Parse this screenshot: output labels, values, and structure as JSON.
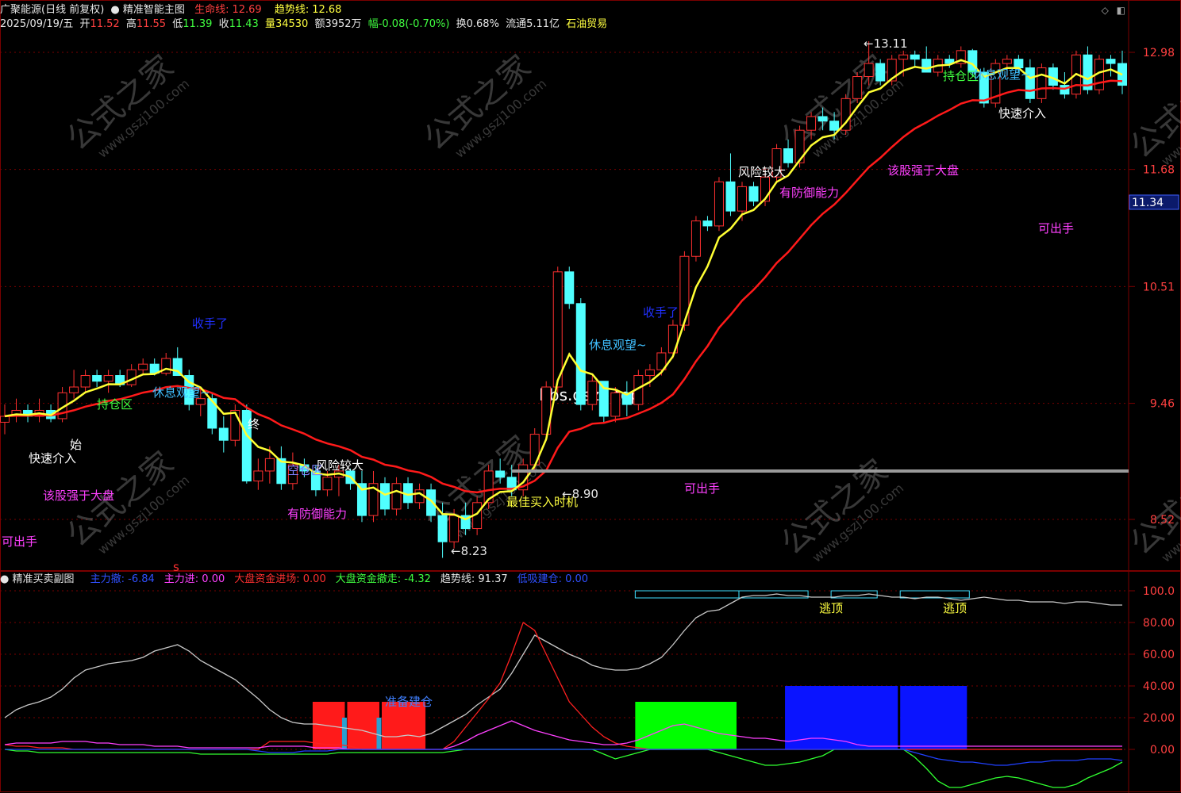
{
  "colors": {
    "bg": "#000000",
    "grid": "#7a0000",
    "up": "#ff3030",
    "down": "#50ffff",
    "life_line": "#ff1a1a",
    "trend_line": "#ffff33",
    "white_line": "#c8c8c8",
    "magenta": "#ff40ff",
    "blue": "#2040ff",
    "green": "#30ff30"
  },
  "header_main": {
    "stock": "广聚能源(日线 前复权)",
    "indicator": "精准智能主图",
    "life_label": "生命线:",
    "life_value": "12.69",
    "trend_label": "趋势线:",
    "trend_value": "12.68",
    "date": "2025/09/19/五",
    "open_label": "开",
    "open": "11.52",
    "high_label": "高",
    "high": "11.55",
    "low_label": "低",
    "low": "11.39",
    "close_label": "收",
    "close": "11.43",
    "vol_label": "量",
    "vol": "34530",
    "amount": "额3952万",
    "change": "幅-0.08(-0.70%)",
    "turnover": "换0.68%",
    "float": "流通5.11亿",
    "industry": "石油贸易"
  },
  "header_sub": {
    "indicator": "精准买卖副图",
    "items": [
      {
        "label": "主力撤: ",
        "value": "-6.84",
        "color": "#3050ff"
      },
      {
        "label": "主力进: ",
        "value": "0.00",
        "color": "#ff40ff"
      },
      {
        "label": "大盘资金进场: ",
        "value": "0.00",
        "color": "#ff3030"
      },
      {
        "label": "大盘资金撤走: ",
        "value": "-4.32",
        "color": "#40ff40"
      },
      {
        "label": "趋势线: ",
        "value": "91.37",
        "color": "#e6e6e6"
      },
      {
        "label": "低吸建仓: ",
        "value": "0.00",
        "color": "#3050ff"
      }
    ]
  },
  "watermark": {
    "brand": "公式之家",
    "url": "www.gszj100.com",
    "site": "bbs.gszb.top"
  },
  "chart_data": [
    {
      "type": "candlestick",
      "y_ticks": [
        "12.98",
        "11.68",
        "10.51",
        "9.46",
        "8.52"
      ],
      "current_price": "11.34",
      "candles": [
        [
          9.3,
          9.45,
          9.2,
          9.35
        ],
        [
          9.35,
          9.5,
          9.3,
          9.4
        ],
        [
          9.4,
          9.45,
          9.3,
          9.35
        ],
        [
          9.35,
          9.5,
          9.3,
          9.4
        ],
        [
          9.4,
          9.45,
          9.3,
          9.33
        ],
        [
          9.33,
          9.6,
          9.3,
          9.55
        ],
        [
          9.55,
          9.75,
          9.5,
          9.6
        ],
        [
          9.6,
          9.75,
          9.55,
          9.7
        ],
        [
          9.7,
          9.75,
          9.6,
          9.65
        ],
        [
          9.65,
          9.75,
          9.55,
          9.7
        ],
        [
          9.7,
          9.75,
          9.6,
          9.62
        ],
        [
          9.62,
          9.8,
          9.6,
          9.75
        ],
        [
          9.75,
          9.85,
          9.7,
          9.8
        ],
        [
          9.8,
          9.85,
          9.7,
          9.72
        ],
        [
          9.72,
          9.9,
          9.7,
          9.85
        ],
        [
          9.85,
          9.95,
          9.7,
          9.7
        ],
        [
          9.7,
          9.75,
          9.4,
          9.45
        ],
        [
          9.45,
          9.6,
          9.35,
          9.5
        ],
        [
          9.5,
          9.55,
          9.2,
          9.25
        ],
        [
          9.25,
          9.35,
          9.05,
          9.15
        ],
        [
          9.15,
          9.45,
          9.1,
          9.4
        ],
        [
          9.4,
          9.45,
          8.8,
          8.82
        ],
        [
          8.82,
          9.0,
          8.75,
          8.9
        ],
        [
          8.9,
          9.1,
          8.8,
          9.0
        ],
        [
          9.0,
          9.1,
          8.75,
          8.8
        ],
        [
          8.8,
          9.05,
          8.75,
          8.95
        ],
        [
          8.95,
          9.0,
          8.85,
          8.9
        ],
        [
          8.9,
          8.95,
          8.7,
          8.75
        ],
        [
          8.75,
          8.9,
          8.7,
          8.85
        ],
        [
          8.85,
          8.95,
          8.7,
          8.9
        ],
        [
          8.9,
          8.92,
          8.75,
          8.8
        ],
        [
          8.8,
          8.9,
          8.5,
          8.55
        ],
        [
          8.55,
          8.9,
          8.5,
          8.8
        ],
        [
          8.8,
          8.85,
          8.55,
          8.6
        ],
        [
          8.6,
          8.85,
          8.55,
          8.8
        ],
        [
          8.8,
          8.85,
          8.6,
          8.65
        ],
        [
          8.65,
          8.8,
          8.6,
          8.75
        ],
        [
          8.75,
          8.8,
          8.5,
          8.55
        ],
        [
          8.55,
          8.65,
          8.23,
          8.35
        ],
        [
          8.35,
          8.6,
          8.3,
          8.55
        ],
        [
          8.55,
          8.65,
          8.4,
          8.45
        ],
        [
          8.45,
          8.7,
          8.4,
          8.65
        ],
        [
          8.65,
          8.95,
          8.6,
          8.9
        ],
        [
          8.9,
          9.0,
          8.8,
          8.85
        ],
        [
          8.85,
          8.95,
          8.7,
          8.75
        ],
        [
          8.75,
          9.0,
          8.7,
          8.95
        ],
        [
          8.95,
          9.25,
          8.9,
          9.2
        ],
        [
          9.2,
          9.65,
          9.15,
          9.6
        ],
        [
          9.6,
          10.7,
          9.55,
          10.65
        ],
        [
          10.65,
          10.7,
          10.3,
          10.35
        ],
        [
          10.35,
          10.4,
          9.4,
          9.45
        ],
        [
          9.45,
          9.7,
          9.4,
          9.65
        ],
        [
          9.65,
          9.6,
          9.3,
          9.35
        ],
        [
          9.35,
          9.6,
          9.3,
          9.55
        ],
        [
          9.55,
          9.65,
          9.35,
          9.45
        ],
        [
          9.45,
          9.75,
          9.4,
          9.7
        ],
        [
          9.7,
          9.8,
          9.6,
          9.75
        ],
        [
          9.75,
          9.95,
          9.7,
          9.9
        ],
        [
          9.9,
          10.2,
          9.85,
          10.15
        ],
        [
          10.15,
          10.85,
          10.1,
          10.8
        ],
        [
          10.8,
          11.2,
          10.75,
          11.15
        ],
        [
          11.15,
          11.2,
          11.05,
          11.1
        ],
        [
          11.1,
          11.6,
          11.05,
          11.55
        ],
        [
          11.55,
          11.85,
          11.2,
          11.25
        ],
        [
          11.25,
          11.55,
          11.15,
          11.5
        ],
        [
          11.5,
          11.55,
          11.3,
          11.35
        ],
        [
          11.35,
          11.7,
          11.3,
          11.6
        ],
        [
          11.6,
          11.95,
          11.55,
          11.9
        ],
        [
          11.9,
          12.0,
          11.7,
          11.75
        ],
        [
          11.75,
          12.15,
          11.7,
          12.1
        ],
        [
          12.1,
          12.3,
          12.0,
          12.25
        ],
        [
          12.25,
          12.35,
          12.1,
          12.2
        ],
        [
          12.2,
          12.3,
          12.0,
          12.1
        ],
        [
          12.1,
          12.5,
          12.05,
          12.45
        ],
        [
          12.45,
          12.75,
          12.4,
          12.7
        ],
        [
          12.7,
          13.11,
          12.6,
          12.85
        ],
        [
          12.85,
          12.9,
          12.6,
          12.65
        ],
        [
          12.65,
          12.95,
          12.6,
          12.9
        ],
        [
          12.9,
          13.0,
          12.7,
          12.95
        ],
        [
          12.95,
          13.0,
          12.8,
          12.9
        ],
        [
          12.9,
          13.05,
          12.75,
          12.75
        ],
        [
          12.75,
          12.95,
          12.7,
          12.9
        ],
        [
          12.9,
          12.95,
          12.8,
          12.85
        ],
        [
          12.85,
          13.05,
          12.8,
          13.0
        ],
        [
          13.0,
          13.02,
          12.7,
          12.75
        ],
        [
          12.75,
          12.8,
          12.35,
          12.4
        ],
        [
          12.4,
          12.9,
          12.35,
          12.85
        ],
        [
          12.85,
          12.95,
          12.7,
          12.9
        ],
        [
          12.9,
          12.95,
          12.75,
          12.8
        ],
        [
          12.8,
          12.9,
          12.4,
          12.45
        ],
        [
          12.45,
          12.85,
          12.4,
          12.8
        ],
        [
          12.8,
          12.85,
          12.55,
          12.6
        ],
        [
          12.6,
          12.75,
          12.45,
          12.5
        ],
        [
          12.5,
          13.0,
          12.45,
          12.95
        ],
        [
          12.95,
          13.05,
          12.5,
          12.55
        ],
        [
          12.55,
          12.95,
          12.5,
          12.9
        ],
        [
          12.9,
          12.95,
          12.7,
          12.85
        ],
        [
          12.85,
          13.0,
          12.5,
          12.6
        ]
      ],
      "annotations": [
        {
          "text": "快速介入",
          "color": "#ffffff"
        },
        {
          "text": "持仓区",
          "color": "#40ff40"
        },
        {
          "text": "休息观望~",
          "color": "#40c0ff"
        },
        {
          "text": "收手了",
          "color": "#2030ff"
        },
        {
          "text": "该股强于大盘",
          "color": "#ff40ff"
        },
        {
          "text": "可出手",
          "color": "#ff40ff"
        },
        {
          "text": "空仓区",
          "color": "#8080ff"
        },
        {
          "text": "风险较大",
          "color": "#ffffff"
        },
        {
          "text": "有防御能力",
          "color": "#ff40ff"
        },
        {
          "text": "最佳买入时机",
          "color": "#ffff40"
        },
        {
          "text": "休息观望~",
          "color": "#40c0ff"
        },
        {
          "text": "收手了",
          "color": "#2030ff"
        },
        {
          "text": "可出手",
          "color": "#ff40ff"
        },
        {
          "text": "风险较大",
          "color": "#ffffff"
        },
        {
          "text": "有防御能力",
          "color": "#ff40ff"
        },
        {
          "text": "该股强于大盘",
          "color": "#ff40ff"
        },
        {
          "text": "可出手",
          "color": "#ff40ff"
        },
        {
          "text": "持仓区",
          "color": "#40ff40"
        },
        {
          "text": "休息观望~",
          "color": "#40c0ff"
        },
        {
          "text": "快速介入",
          "color": "#ffffff"
        },
        {
          "text": "始",
          "color": "#ffffff"
        },
        {
          "text": "终",
          "color": "#ffffff"
        },
        {
          "text": "←8.23",
          "color": "#e6e6e6"
        },
        {
          "text": "←8.90",
          "color": "#e6e6e6"
        },
        {
          "text": "←13.11",
          "color": "#e6e6e6"
        },
        {
          "text": "s",
          "color": "#ff3030"
        }
      ]
    },
    {
      "type": "line",
      "y_ticks": [
        "100.0",
        "80.00",
        "60.00",
        "40.00",
        "20.00",
        "0.00"
      ],
      "ylim": [
        -25,
        100
      ],
      "trend_line": [
        20,
        25,
        28,
        30,
        33,
        38,
        45,
        50,
        52,
        54,
        55,
        56,
        58,
        62,
        64,
        66,
        62,
        56,
        52,
        48,
        44,
        38,
        32,
        25,
        20,
        17,
        16,
        16,
        15,
        14,
        13,
        12,
        10,
        8,
        8,
        9,
        8,
        10,
        14,
        18,
        22,
        28,
        33,
        38,
        48,
        60,
        72,
        68,
        64,
        60,
        57,
        53,
        51,
        50,
        50,
        51,
        54,
        58,
        66,
        75,
        83,
        87,
        88,
        92,
        96,
        97,
        97,
        98,
        97,
        97,
        96,
        96,
        96,
        97,
        97,
        98,
        97,
        96,
        96,
        95,
        96,
        96,
        95,
        94,
        95,
        96,
        95,
        94,
        94,
        93,
        93,
        93,
        92,
        93,
        93,
        92,
        91,
        91
      ],
      "red_line": [
        3,
        2,
        2,
        1,
        1,
        1,
        0,
        0,
        0,
        0,
        0,
        0,
        0,
        0,
        0,
        0,
        0,
        0,
        0,
        0,
        0,
        0,
        0,
        5,
        5,
        5,
        5,
        4,
        3,
        3,
        2,
        0,
        0,
        0,
        0,
        0,
        0,
        0,
        0,
        5,
        14,
        23,
        32,
        42,
        60,
        80,
        75,
        60,
        45,
        30,
        22,
        14,
        8,
        4,
        2,
        1,
        0,
        0,
        0,
        0,
        0,
        0,
        0,
        0,
        0,
        0,
        0,
        0,
        0,
        0,
        0,
        0,
        0,
        0,
        0,
        0,
        0,
        0,
        0,
        0,
        0,
        0,
        0,
        0,
        0,
        0,
        0,
        0,
        0,
        0,
        0,
        0,
        0,
        0,
        0,
        0,
        0,
        0
      ],
      "magenta_line": [
        3,
        4,
        4,
        4,
        4,
        5,
        5,
        5,
        4,
        4,
        3,
        3,
        3,
        2,
        2,
        2,
        1,
        1,
        1,
        1,
        1,
        1,
        1,
        2,
        2,
        2,
        2,
        1,
        1,
        1,
        0,
        0,
        0,
        0,
        0,
        0,
        0,
        0,
        0,
        2,
        5,
        9,
        12,
        15,
        18,
        15,
        12,
        10,
        8,
        6,
        5,
        4,
        3,
        3,
        4,
        6,
        9,
        12,
        15,
        16,
        14,
        12,
        10,
        9,
        8,
        7,
        7,
        6,
        5,
        6,
        7,
        7,
        6,
        5,
        3,
        2,
        2,
        2,
        2,
        2,
        2,
        2,
        2,
        2,
        2,
        2,
        2,
        2,
        2,
        2,
        2,
        2,
        2,
        2,
        2,
        2,
        2,
        2
      ],
      "green_line": [
        0,
        -1,
        -1,
        -2,
        -2,
        -2,
        -2,
        -2,
        -2,
        -2,
        -2,
        -2,
        -2,
        -2,
        -2,
        -2,
        -2,
        -3,
        -3,
        -3,
        -3,
        -3,
        -3,
        -3,
        -3,
        -3,
        -3,
        -3,
        -3,
        -2,
        -2,
        -2,
        -2,
        -2,
        -2,
        -2,
        -2,
        -2,
        -2,
        -1,
        0,
        0,
        0,
        0,
        0,
        0,
        0,
        0,
        0,
        0,
        0,
        0,
        -3,
        -6,
        -4,
        -2,
        0,
        0,
        0,
        0,
        0,
        0,
        -2,
        -4,
        -6,
        -8,
        -10,
        -10,
        -9,
        -8,
        -6,
        -4,
        0,
        0,
        0,
        0,
        0,
        0,
        0,
        -5,
        -12,
        -20,
        -24,
        -24,
        -22,
        -20,
        -18,
        -17,
        -18,
        -20,
        -22,
        -24,
        -24,
        -22,
        -18,
        -15,
        -12,
        -8
      ],
      "blue_line": [
        0,
        0,
        0,
        0,
        0,
        0,
        0,
        0,
        0,
        0,
        0,
        0,
        0,
        0,
        0,
        0,
        0,
        0,
        0,
        0,
        0,
        0,
        -1,
        -2,
        -2,
        -2,
        -1,
        -1,
        -1,
        0,
        0,
        0,
        0,
        0,
        0,
        0,
        0,
        0,
        0,
        0,
        0,
        0,
        0,
        0,
        0,
        0,
        0,
        0,
        0,
        0,
        0,
        0,
        0,
        0,
        0,
        0,
        0,
        0,
        0,
        0,
        0,
        0,
        0,
        0,
        0,
        0,
        0,
        0,
        0,
        0,
        0,
        0,
        0,
        0,
        0,
        0,
        0,
        0,
        0,
        -2,
        -4,
        -6,
        -7,
        -8,
        -8,
        -9,
        -10,
        -10,
        -9,
        -8,
        -8,
        -7,
        -7,
        -7,
        -6,
        -6,
        -6,
        -7
      ],
      "labels": [
        {
          "text": "准备建仓",
          "color": "#4080ff"
        },
        {
          "text": "逃顶",
          "color": "#ffff40"
        },
        {
          "text": "逃顶",
          "color": "#ffff40"
        }
      ]
    }
  ]
}
